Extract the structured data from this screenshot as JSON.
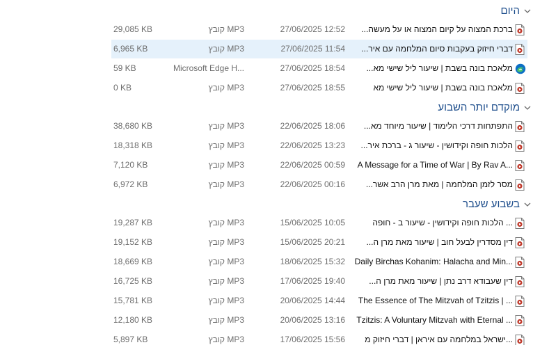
{
  "groups": [
    {
      "title": "היום",
      "rows": [
        {
          "name": "ברכת המצוה על קיום המצוה או על מעשה...",
          "date": "27/06/2025 12:52",
          "type": "קובץ MP3",
          "size": "29,085 KB",
          "icon": "audio-file-icon",
          "selected": false
        },
        {
          "name": "דברי חיזוק בעקבות סיום המלחמה עם איר...",
          "date": "27/06/2025 11:54",
          "type": "קובץ MP3",
          "size": "6,965 KB",
          "icon": "audio-file-icon",
          "selected": true
        },
        {
          "name": "מלאכת בונה בשבת   |   שיעור ליל שישי מא...",
          "date": "27/06/2025 18:54",
          "type": "Microsoft Edge H...",
          "size": "59 KB",
          "icon": "edge-html-file-icon",
          "selected": false
        },
        {
          "name": "מלאכת בונה בשבת   |   שיעור ליל שישי מא",
          "date": "27/06/2025 18:55",
          "type": "קובץ MP3",
          "size": "0 KB",
          "icon": "audio-file-icon",
          "selected": false
        }
      ]
    },
    {
      "title": "מוקדם יותר השבוע",
      "rows": [
        {
          "name": "התפתחות דרכי הלימוד   |   שיעור מיוחד מא...",
          "date": "22/06/2025 18:06",
          "type": "קובץ MP3",
          "size": "38,680 KB",
          "icon": "audio-file-icon",
          "selected": false
        },
        {
          "name": "הלכות חופה וקידושין - שיעור ג - ברכת איר...",
          "date": "22/06/2025 13:23",
          "type": "קובץ MP3",
          "size": "18,318 KB",
          "icon": "audio-file-icon",
          "selected": false
        },
        {
          "name": "A Message for a Time of War  |  By Rav A...",
          "date": "22/06/2025 00:59",
          "type": "קובץ MP3",
          "size": "7,120 KB",
          "icon": "audio-file-icon",
          "selected": false
        },
        {
          "name": "מסר לזמן המלחמה   |   מאת מרן הרב אשר...",
          "date": "22/06/2025 00:16",
          "type": "קובץ MP3",
          "size": "6,972 KB",
          "icon": "audio-file-icon",
          "selected": false
        }
      ]
    },
    {
      "title": "בשבוע שעבר",
      "rows": [
        {
          "name": "... הלכות חופה וקידושין - שיעור ב - חופה",
          "date": "15/06/2025 10:05",
          "type": "קובץ MP3",
          "size": "19,287 KB",
          "icon": "audio-file-icon",
          "selected": false
        },
        {
          "name": "דין מסדרין לבעל חוב   |   שיעור מאת מרן ה...",
          "date": "15/06/2025 20:21",
          "type": "קובץ MP3",
          "size": "19,152 KB",
          "icon": "audio-file-icon",
          "selected": false
        },
        {
          "name": "Daily Birchas Kohanim: Halacha and Min...",
          "date": "18/06/2025 15:32",
          "type": "קובץ MP3",
          "size": "18,669 KB",
          "icon": "audio-file-icon",
          "selected": false
        },
        {
          "name": "דין שעבודא דרב נתן   |   שיעור מאת מרן ה...",
          "date": "17/06/2025 19:40",
          "type": "קובץ MP3",
          "size": "16,725 KB",
          "icon": "audio-file-icon",
          "selected": false
        },
        {
          "name": "The Essence of The Mitzvah of Tzitzis   |   ...",
          "date": "20/06/2025 14:44",
          "type": "קובץ MP3",
          "size": "15,781 KB",
          "icon": "audio-file-icon",
          "selected": false
        },
        {
          "name": "Tzitzis: A Voluntary Mitzvah with Eternal ...",
          "date": "20/06/2025 13:16",
          "type": "קובץ MP3",
          "size": "12,180 KB",
          "icon": "audio-file-icon",
          "selected": false
        },
        {
          "name": "...ישראל במלחמה עם איראן   |   דברי חיזוק מ",
          "date": "17/06/2025 15:56",
          "type": "קובץ MP3",
          "size": "5,897 KB",
          "icon": "audio-file-icon",
          "selected": false
        }
      ]
    }
  ],
  "colors": {
    "group_header": "#1e4e8c",
    "selected_row": "#e5f1fb",
    "secondary_text": "#6d6d6d",
    "audio_icon_accent": "#c0392b"
  }
}
